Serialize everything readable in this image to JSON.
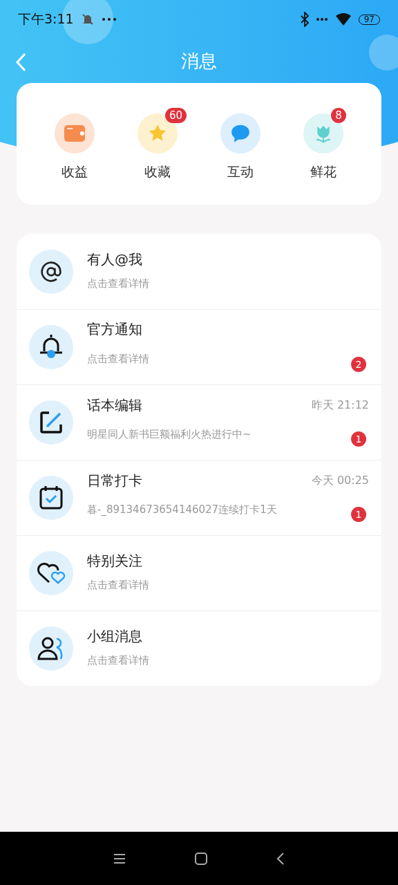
{
  "status_bar": {
    "time": "下午3:11",
    "battery": "97"
  },
  "header": {
    "title": "消息"
  },
  "shortcuts": [
    {
      "kind": "wallet",
      "label": "收益"
    },
    {
      "kind": "star",
      "label": "收藏",
      "badge": "60"
    },
    {
      "kind": "chat",
      "label": "互动"
    },
    {
      "kind": "flower",
      "label": "鲜花",
      "badge": "8"
    }
  ],
  "messages": [
    {
      "kind": "at",
      "title": "有人@我",
      "subtitle": "点击查看详情"
    },
    {
      "kind": "bell",
      "title": "官方通知",
      "subtitle": "点击查看详情",
      "badge": "2"
    },
    {
      "kind": "edit",
      "title": "话本编辑",
      "subtitle": "明星同人新书巨额福利火热进行中~",
      "time": "昨天 21:12",
      "badge": "1"
    },
    {
      "kind": "calendar",
      "title": "日常打卡",
      "subtitle": "暮-_89134673654146027连续打卡1天",
      "time": "今天 00:25",
      "badge": "1"
    },
    {
      "kind": "hearts",
      "title": "特别关注",
      "subtitle": "点击查看详情"
    },
    {
      "kind": "group",
      "title": "小组消息",
      "subtitle": "点击查看详情"
    }
  ]
}
